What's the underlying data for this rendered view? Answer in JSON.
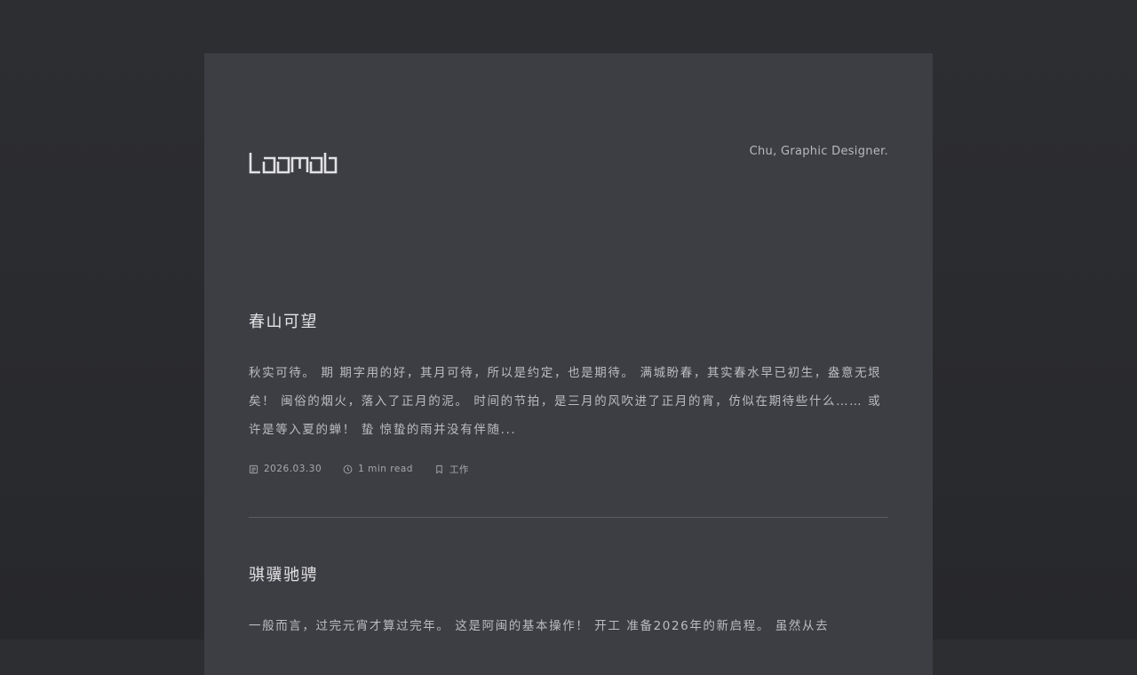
{
  "header": {
    "logo_icon": "loomob-logo-icon",
    "tagline": "Chu, Graphic Designer."
  },
  "posts": [
    {
      "title": "春山可望",
      "excerpt": "秋实可待。 期 期字用的好，其月可待，所以是约定，也是期待。 满城盼春，其实春水早已初生，盎意无垠矣！ 闽俗的烟火，落入了正月的泥。 时间的节拍，是三月的风吹进了正月的宵，仿似在期待些什么…… 或许是等入夏的蝉！ 蛰 惊蛰的雨并没有伴随...",
      "meta": {
        "date": "2026.03.30",
        "read_time": "1 min read",
        "category": "工作"
      }
    },
    {
      "title": "骐骥驰骋",
      "excerpt": "一般而言，过完元宵才算过完年。 这是阿闽的基本操作！ 开工 准备2026年的新启程。 虽然从去"
    }
  ],
  "icons": {
    "date": "calendar-icon",
    "read_time": "clock-icon",
    "category": "bookmark-icon"
  },
  "colors": {
    "background": "#2a2b2f",
    "card": "#3d3e43",
    "title": "#e3e3e6",
    "text": "#bcbcc0",
    "meta": "#a7a7ab",
    "divider": "#5c5d62"
  }
}
